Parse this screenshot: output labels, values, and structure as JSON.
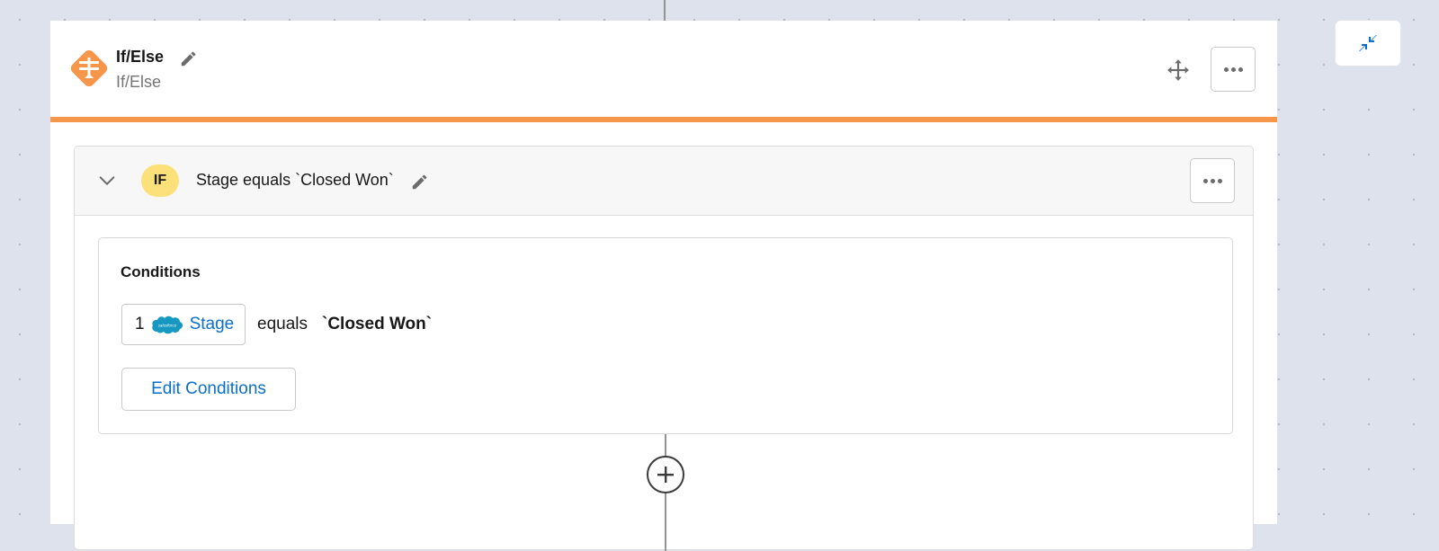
{
  "node": {
    "title": "If/Else",
    "subtitle": "If/Else",
    "accent_color": "#f6964b",
    "icons": {
      "node": "if-else-signpost-icon",
      "edit": "pencil-icon",
      "move": "move-arrows-icon",
      "more": "more-horizontal-icon"
    }
  },
  "canvas": {
    "collapse_icon": "collapse-arrows-icon"
  },
  "branch": {
    "badge": "IF",
    "badge_color": "#fce17a",
    "title": "Stage equals `Closed Won`",
    "expanded": true,
    "conditions": {
      "heading": "Conditions",
      "items": [
        {
          "step_number": "1",
          "source": "salesforce",
          "source_label": "salesforce",
          "field": "Stage",
          "operator": "equals",
          "value": "`Closed Won`"
        }
      ],
      "edit_button_label": "Edit Conditions"
    },
    "add_step_icon": "plus-circle-icon"
  }
}
